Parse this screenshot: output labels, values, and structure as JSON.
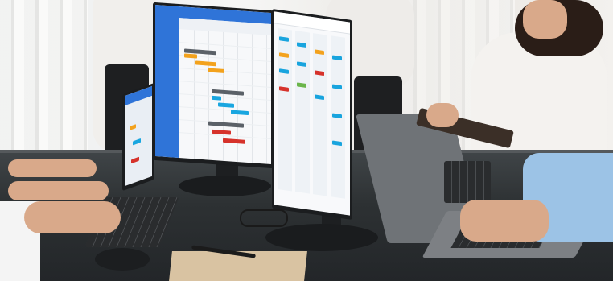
{
  "scene": {
    "description_free": true,
    "monitors": {
      "left_screen": {
        "sidebar_color": "#2f74d8",
        "header_tabs": [
          "",
          "",
          "",
          "",
          ""
        ],
        "task_colors": [
          "#f3a21d",
          "#19a6e0",
          "#d6322b",
          "#8a8f96"
        ]
      },
      "right_screen": {
        "card_colors": [
          "#18a4de",
          "#f3a21d",
          "#d6322b",
          "#6ab54a"
        ]
      }
    },
    "palette": {
      "desk": "#2d3133",
      "wall": "#f3f1ee",
      "shirt_white": "#f4f2ef",
      "shirt_blue": "#9cc3e6",
      "skin": "#d9a98a"
    }
  }
}
